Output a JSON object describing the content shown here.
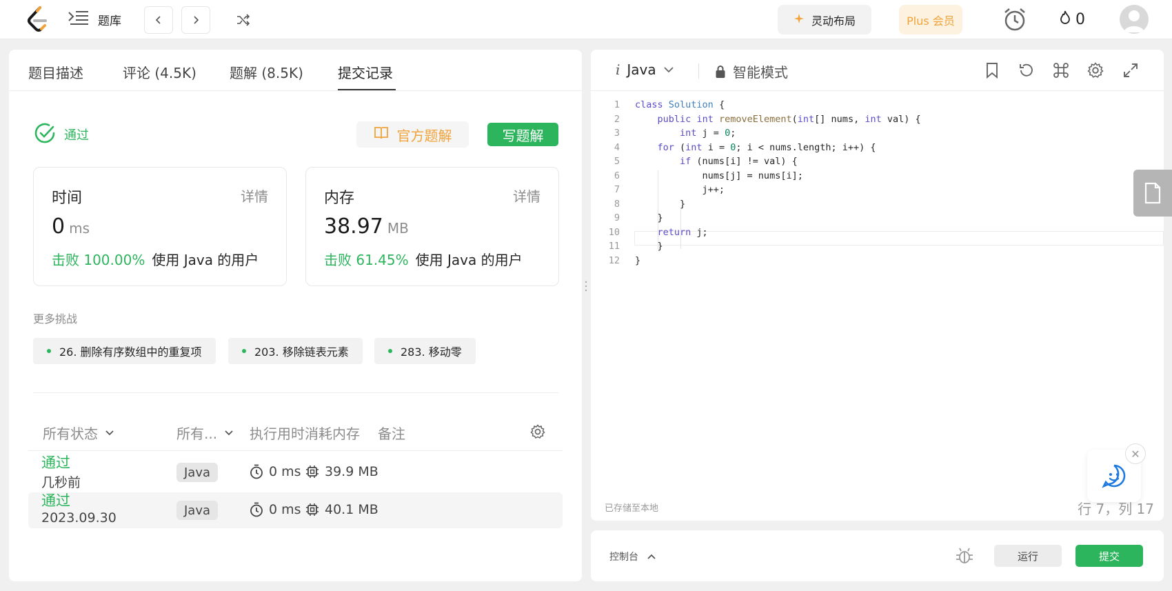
{
  "nav": {
    "problem_list_label": "题库",
    "dynamic_layout_label": "灵动布局",
    "plus_label": "Plus 会员",
    "streak_count": "0"
  },
  "tabs": [
    {
      "label": "题目描述"
    },
    {
      "label": "评论 (4.5K)"
    },
    {
      "label": "题解 (8.5K)"
    },
    {
      "label": "提交记录"
    }
  ],
  "result": {
    "status": "通过",
    "official_solution_label": "官方题解",
    "write_solution_label": "写题解"
  },
  "runtime_card": {
    "title": "时间",
    "detail": "详情",
    "value": "0",
    "unit": "ms",
    "beat_pct": "击败 100.00%",
    "beat_suffix": "使用 Java 的用户"
  },
  "memory_card": {
    "title": "内存",
    "detail": "详情",
    "value": "38.97",
    "unit": "MB",
    "beat_pct": "击败 61.45%",
    "beat_suffix": "使用 Java 的用户"
  },
  "more_challenges": {
    "label": "更多挑战",
    "items": [
      "26. 删除有序数组中的重复项",
      "203. 移除链表元素",
      "283. 移动零"
    ]
  },
  "table": {
    "headers": {
      "status": "所有状态",
      "language": "所有...",
      "runtime": "执行用时",
      "memory": "消耗内存",
      "notes": "备注"
    },
    "rows": [
      {
        "status": "通过",
        "time": "几秒前",
        "lang": "Java",
        "runtime": "0 ms",
        "memory": "39.9 MB"
      },
      {
        "status": "通过",
        "time": "2023.09.30",
        "lang": "Java",
        "runtime": "0 ms",
        "memory": "40.1 MB"
      }
    ]
  },
  "editor": {
    "language": "Java",
    "mode": "智能模式",
    "saved_label": "已存储至本地",
    "cursor_pos": "行 7，列 17",
    "line_numbers": [
      "1",
      "2",
      "3",
      "4",
      "5",
      "6",
      "7",
      "8",
      "9",
      "10",
      "11",
      "12"
    ]
  },
  "console": {
    "label": "控制台",
    "run_label": "运行",
    "submit_label": "提交"
  },
  "colors": {
    "accent_green": "#2db55d",
    "accent_orange": "#f0a33a"
  }
}
